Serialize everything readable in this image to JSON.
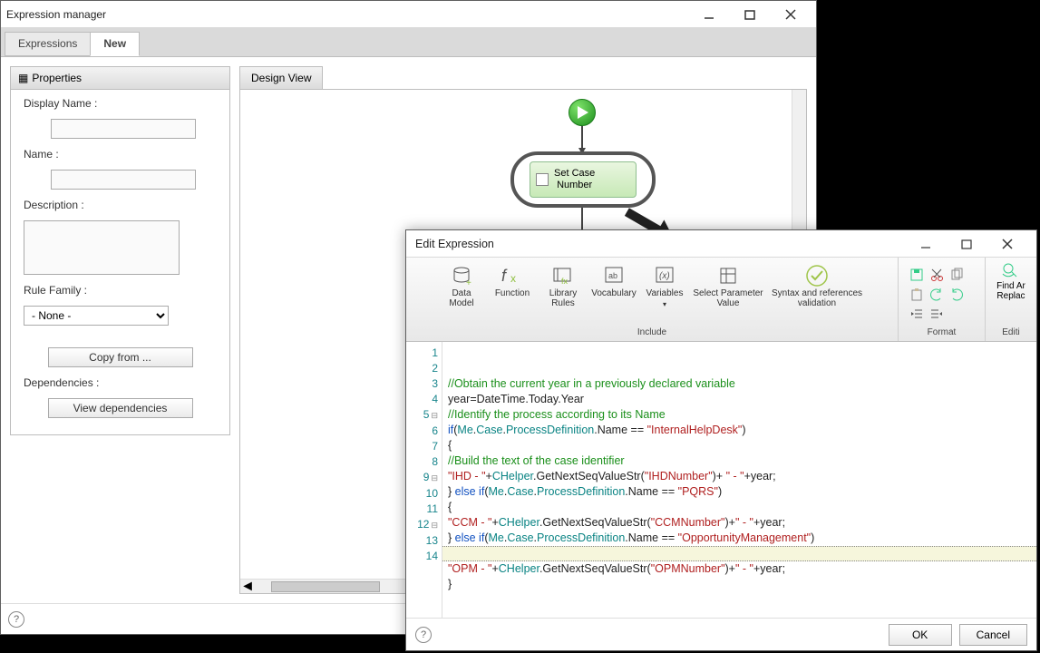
{
  "em": {
    "title": "Expression manager",
    "tabs": {
      "expressions": "Expressions",
      "new": "New"
    },
    "properties": {
      "panel_title": "Properties",
      "display_name_label": "Display Name :",
      "display_name_value": "",
      "name_label": "Name :",
      "name_value": "",
      "description_label": "Description :",
      "description_value": "",
      "rule_family_label": "Rule Family :",
      "rule_family_value": "- None -",
      "copy_from_label": "Copy from ...",
      "dependencies_label": "Dependencies :",
      "view_dependencies_label": "View dependencies"
    },
    "design_view": {
      "tab_label": "Design View",
      "task_label_line1": "Set Case",
      "task_label_line2": "Number"
    }
  },
  "ex": {
    "title": "Edit Expression",
    "ribbon": {
      "include": {
        "data_model": "Data\nModel",
        "function": "Function",
        "library_rules": "Library\nRules",
        "vocabulary": "Vocabulary",
        "variables": "Variables",
        "select_param": "Select Parameter\nValue",
        "syntax_valid": "Syntax and references\nvalidation",
        "group": "Include"
      },
      "format": {
        "group": "Format"
      },
      "editing": {
        "find": "Find Ar",
        "replace": "Replac",
        "group": "Editi"
      }
    },
    "code": {
      "l1": "//Obtain the current year in a previously declared variable",
      "l2a": "year=DateTime.Today.Year",
      "l3": "//Identify the process according to its Name",
      "l4_if": "if",
      "l4_me": "Me",
      "l4_case": "Case",
      "l4_pd": "ProcessDefinition",
      "l4_name": "Name",
      "l4_str": "\"InternalHelpDesk\"",
      "l6": "//Build the text of the case identifier",
      "l7_pref": "\"IHD - \"",
      "l7_help": "CHelper",
      "l7_fn": "GetNextSeqValueStr",
      "l7_arg": "\"IHDNumber\"",
      "l7_suf": "\" - \"",
      "l8_else": "else if",
      "l8_str": "\"PQRS\"",
      "l10_pref": "\"CCM - \"",
      "l10_arg": "\"CCMNumber\"",
      "l11_str": "\"OpportunityManagement\"",
      "l13_pref": "\"OPM - \"",
      "l13_arg": "\"OPMNumber\""
    },
    "buttons": {
      "ok": "OK",
      "cancel": "Cancel"
    }
  }
}
